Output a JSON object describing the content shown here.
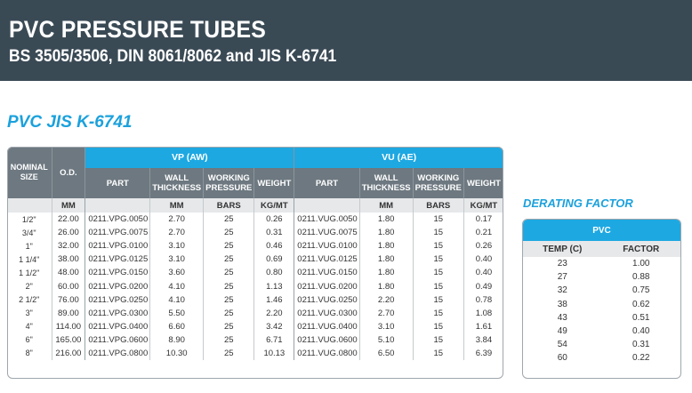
{
  "header": {
    "title": "PVC PRESSURE TUBES",
    "subtitle": "BS 3505/3506, DIN 8061/8062 and JIS K-6741"
  },
  "section_title": "PVC JIS K-6741",
  "main_table": {
    "col_nominal_size": "NOMINAL SIZE",
    "col_od": "O.D.",
    "group_vp": "VP (AW)",
    "group_vu": "VU (AE)",
    "sub_part": "PART",
    "sub_wall": "WALL THICKNESS",
    "sub_working": "WORKING PRESSURE",
    "sub_weight": "WEIGHT",
    "unit_mm": "MM",
    "unit_bars": "BARS",
    "unit_kgmt": "KG/MT",
    "rows": [
      {
        "size": "1/2\"",
        "od": "22.00",
        "vp_part": "0211.VPG.0050",
        "vp_wall": "2.70",
        "vp_bars": "25",
        "vp_weight": "0.26",
        "vu_part": "0211.VUG.0050",
        "vu_wall": "1.80",
        "vu_bars": "15",
        "vu_weight": "0.17"
      },
      {
        "size": "3/4\"",
        "od": "26.00",
        "vp_part": "0211.VPG.0075",
        "vp_wall": "2.70",
        "vp_bars": "25",
        "vp_weight": "0.31",
        "vu_part": "0211.VUG.0075",
        "vu_wall": "1.80",
        "vu_bars": "15",
        "vu_weight": "0.21"
      },
      {
        "size": "1\"",
        "od": "32.00",
        "vp_part": "0211.VPG.0100",
        "vp_wall": "3.10",
        "vp_bars": "25",
        "vp_weight": "0.46",
        "vu_part": "0211.VUG.0100",
        "vu_wall": "1.80",
        "vu_bars": "15",
        "vu_weight": "0.26"
      },
      {
        "size": "1 1/4\"",
        "od": "38.00",
        "vp_part": "0211.VPG.0125",
        "vp_wall": "3.10",
        "vp_bars": "25",
        "vp_weight": "0.69",
        "vu_part": "0211.VUG.0125",
        "vu_wall": "1.80",
        "vu_bars": "15",
        "vu_weight": "0.40"
      },
      {
        "size": "1 1/2\"",
        "od": "48.00",
        "vp_part": "0211.VPG.0150",
        "vp_wall": "3.60",
        "vp_bars": "25",
        "vp_weight": "0.80",
        "vu_part": "0211.VUG.0150",
        "vu_wall": "1.80",
        "vu_bars": "15",
        "vu_weight": "0.40"
      },
      {
        "size": "2\"",
        "od": "60.00",
        "vp_part": "0211.VPG.0200",
        "vp_wall": "4.10",
        "vp_bars": "25",
        "vp_weight": "1.13",
        "vu_part": "0211.VUG.0200",
        "vu_wall": "1.80",
        "vu_bars": "15",
        "vu_weight": "0.49"
      },
      {
        "size": "2 1/2\"",
        "od": "76.00",
        "vp_part": "0211.VPG.0250",
        "vp_wall": "4.10",
        "vp_bars": "25",
        "vp_weight": "1.46",
        "vu_part": "0211.VUG.0250",
        "vu_wall": "2.20",
        "vu_bars": "15",
        "vu_weight": "0.78"
      },
      {
        "size": "3\"",
        "od": "89.00",
        "vp_part": "0211.VPG.0300",
        "vp_wall": "5.50",
        "vp_bars": "25",
        "vp_weight": "2.20",
        "vu_part": "0211.VUG.0300",
        "vu_wall": "2.70",
        "vu_bars": "15",
        "vu_weight": "1.08"
      },
      {
        "size": "4\"",
        "od": "114.00",
        "vp_part": "0211.VPG.0400",
        "vp_wall": "6.60",
        "vp_bars": "25",
        "vp_weight": "3.42",
        "vu_part": "0211.VUG.0400",
        "vu_wall": "3.10",
        "vu_bars": "15",
        "vu_weight": "1.61"
      },
      {
        "size": "6\"",
        "od": "165.00",
        "vp_part": "0211.VPG.0600",
        "vp_wall": "8.90",
        "vp_bars": "25",
        "vp_weight": "6.71",
        "vu_part": "0211.VUG.0600",
        "vu_wall": "5.10",
        "vu_bars": "15",
        "vu_weight": "3.84"
      },
      {
        "size": "8\"",
        "od": "216.00",
        "vp_part": "0211.VPG.0800",
        "vp_wall": "10.30",
        "vp_bars": "25",
        "vp_weight": "10.13",
        "vu_part": "0211.VUG.0800",
        "vu_wall": "6.50",
        "vu_bars": "15",
        "vu_weight": "6.39"
      }
    ]
  },
  "derating": {
    "title": "DERATING FACTOR",
    "header": "PVC",
    "col_temp": "TEMP (C)",
    "col_factor": "FACTOR",
    "rows": [
      {
        "temp": "23",
        "factor": "1.00"
      },
      {
        "temp": "27",
        "factor": "0.88"
      },
      {
        "temp": "32",
        "factor": "0.75"
      },
      {
        "temp": "38",
        "factor": "0.62"
      },
      {
        "temp": "43",
        "factor": "0.51"
      },
      {
        "temp": "49",
        "factor": "0.40"
      },
      {
        "temp": "54",
        "factor": "0.31"
      },
      {
        "temp": "60",
        "factor": "0.22"
      }
    ]
  },
  "colors": {
    "banner": "#3a4a55",
    "accent_blue": "#1da8e2",
    "header_grey": "#6d7880",
    "unit_row": "#e6e8ea"
  }
}
